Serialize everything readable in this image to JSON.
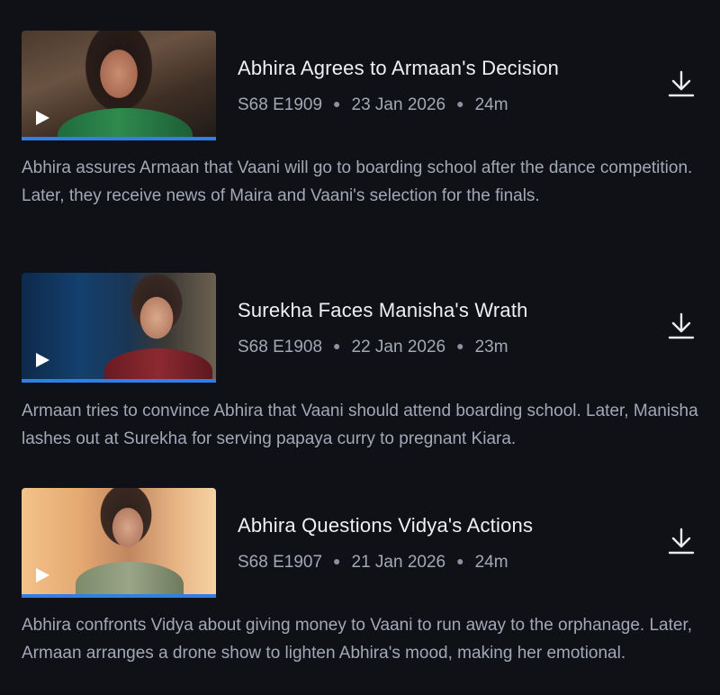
{
  "episodes": [
    {
      "title": "Abhira Agrees to Armaan's Decision",
      "episode_code": "S68 E1909",
      "date": "23 Jan 2026",
      "duration": "24m",
      "watch_progress_percent": 100,
      "description": "Abhira assures Armaan that Vaani will go to boarding school after the dance competition. Later, they receive news of Maira and Vaani's selection for the finals.",
      "play_icon": "play-icon",
      "download_icon": "download-icon"
    },
    {
      "title": "Surekha Faces Manisha's Wrath",
      "episode_code": "S68 E1908",
      "date": "22 Jan 2026",
      "duration": "23m",
      "watch_progress_percent": 100,
      "description": "Armaan tries to convince Abhira that Vaani should attend boarding school. Later, Manisha lashes out at Surekha for serving papaya curry to pregnant Kiara.",
      "play_icon": "play-icon",
      "download_icon": "download-icon"
    },
    {
      "title": "Abhira Questions Vidya's Actions",
      "episode_code": "S68 E1907",
      "date": "21 Jan 2026",
      "duration": "24m",
      "watch_progress_percent": 100,
      "description": "Abhira confronts Vidya about giving money to Vaani to run away to the orphanage. Later, Armaan arranges a drone show to lighten Abhira's mood, making her emotional.",
      "play_icon": "play-icon",
      "download_icon": "download-icon"
    }
  ],
  "colors": {
    "background": "#101116",
    "title_text": "#eef0f5",
    "secondary_text": "#a3a8b6",
    "progress_accent": "#2f7fe6"
  }
}
